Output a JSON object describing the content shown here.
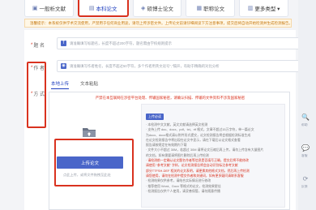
{
  "type_tabs": [
    {
      "icon": "▣",
      "label": "一般析文献",
      "active": false
    },
    {
      "icon": "▤",
      "label": "本科论文",
      "active": true
    },
    {
      "icon": "◈",
      "label": "硕博士论文",
      "active": false
    },
    {
      "icon": "▦",
      "label": "职称论文",
      "active": false
    },
    {
      "icon": "▥",
      "label": "更多类型 ▾",
      "active": false
    }
  ],
  "notice": "温馨提示：本系统仅供学术交流使用，严禁用于任何商业用途，请勿上传涉密文件。上传论文前请仔细阅读下方注意事项，提交后将自动开始检测并生成检测报告。",
  "fields": {
    "title_label": "题 名",
    "author_label": "作 者",
    "third_label": "方 式",
    "title_placeholder": "请准确填写标题名，长度不超过200字符，题名需由学校规则提示",
    "author_placeholder": "请准确填写作者姓名，长度不超过50字符，多个作者用英文逗号“,”隔开，有助于精确的对比分析"
  },
  "sub_tabs": [
    {
      "label": "本地上传",
      "active": true
    },
    {
      "label": "文本粘贴",
      "active": false
    }
  ],
  "upload": {
    "warning": "严禁在本互联网在涉密平台处理、传输国家秘密，请确认扫描、传输的文件资料不涉及国家秘密",
    "button": "上传论文",
    "hint": "点此上传，或将文件拖拽至此处"
  },
  "notes": {
    "badge": "上传必读",
    "lines": [
      {
        "text": "· 本检测中文文献，英文文献请选择英文检测",
        "red": false
      },
      {
        "text": "· 支持上传 doc、docx、pdf、txt、rtf 格式，文章不超过15万字符，单一篇论文",
        "red": false
      },
      {
        "text": "  为docx、docx格式请以附件形式提交，论文检测报告将会根据检测标准生成",
        "red": false
      },
      {
        "text": "  在论文检测报告中将出现在论文中显示，请在下载后以论文格式查看",
        "red": false
      },
      {
        "text": "  报告请按规定在有效期内下载",
        "red": false
      },
      {
        "text": "· 文件大小不超过 30M，若超过 30M 请将论文压缩后再上传，请勿上传含有大量图片",
        "red": false
      },
      {
        "text": "  的文档，如有需要请将图片删除后再上传检测",
        "red": false
      },
      {
        "text": "· 请检测前一定确认论文题名作者等信息是否填写正确，提交后将不能修改",
        "red": true
      },
      {
        "text": "  请使用 “参考文献” 字样，论文检测报告将会自动识别标注参考文献",
        "red": true
      },
      {
        "text": "  部分TTFSH-DEF 相关的论文表明，请更换其他格式文档，然后再上传检测",
        "red": true
      },
      {
        "text": "  请您使用，请勿在检测中提交作者和关键词，如有更多疑问请联系客服",
        "red": true
      },
      {
        "text": "· 检测结果仅供参考，请结合实际情况进行修改",
        "red": false
      },
      {
        "text": "· 推荐使用 Word、Docx 等格式的论文，检测效果更佳",
        "red": false
      },
      {
        "text": "· 检测报告仅供个人使用，请妥善保管，请勿随意传播",
        "red": false
      }
    ]
  },
  "right_gutter": {
    "icon1": "🔍",
    "icon2": "💬",
    "icon3": "⟳",
    "text1": "帮助",
    "text2": "客服",
    "text3": "反馈"
  }
}
